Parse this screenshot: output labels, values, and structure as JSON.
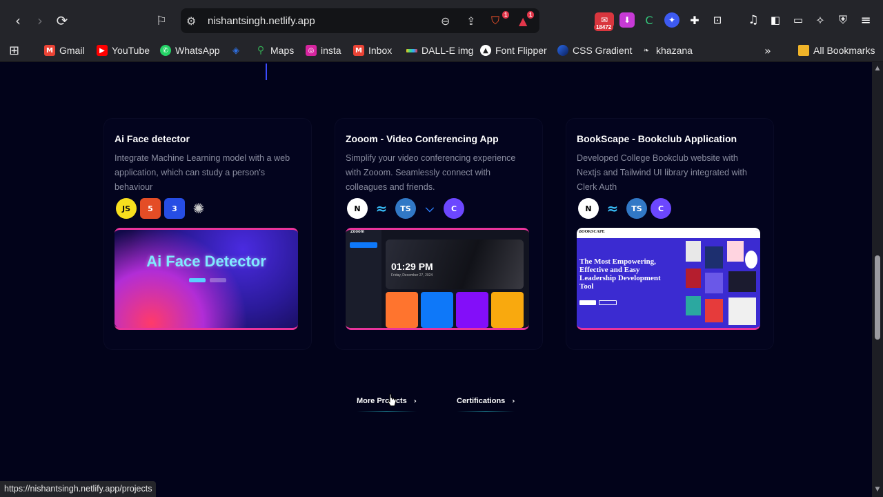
{
  "browser": {
    "url": "nishantsingh.netlify.app",
    "extension_badges": {
      "brave": "1",
      "alert": "1",
      "counter": "18472"
    },
    "status_url": "https://nishantsingh.netlify.app/projects"
  },
  "bookmarks": [
    {
      "label": "Gmail",
      "icon": "gmail-icon",
      "color": "#ea4335"
    },
    {
      "label": "YouTube",
      "icon": "youtube-icon",
      "color": "#ff0000"
    },
    {
      "label": "WhatsApp",
      "icon": "whatsapp-icon",
      "color": "#25d366"
    },
    {
      "label": "",
      "icon": "bookmark-generic-icon",
      "color": "#2f6fe0"
    },
    {
      "label": "Maps",
      "icon": "maps-pin-icon",
      "color": "#34a853"
    },
    {
      "label": "insta",
      "icon": "instagram-icon",
      "color": "#d6249f"
    },
    {
      "label": "Inbox",
      "icon": "gmail-icon",
      "color": "#ea4335"
    },
    {
      "label": "DALL-E img",
      "icon": "dalle-icon",
      "color": "#f5c518"
    },
    {
      "label": "Font Flipper",
      "icon": "font-flipper-icon",
      "color": "#ffffff"
    },
    {
      "label": "CSS Gradient",
      "icon": "css-gradient-icon",
      "color": "#2a6ae8"
    },
    {
      "label": "khazana",
      "icon": "khazana-icon",
      "color": "#dddddd"
    }
  ],
  "all_bookmarks_label": "All Bookmarks",
  "projects": [
    {
      "title": "Ai Face detector",
      "description": "Integrate Machine Learning model with a web application, which can study a person's behaviour",
      "tech": [
        {
          "icon": "javascript-icon",
          "text": "JS"
        },
        {
          "icon": "html5-icon",
          "text": "5"
        },
        {
          "icon": "css3-icon",
          "text": "3"
        },
        {
          "icon": "openai-icon",
          "text": "✺"
        }
      ],
      "thumb_text": "Ai Face Detector"
    },
    {
      "title": "Zooom - Video Conferencing App",
      "description": "Simplify your video conferencing experience with Zooom. Seamlessly connect with colleagues and friends.",
      "tech": [
        {
          "icon": "nextjs-icon",
          "text": "N"
        },
        {
          "icon": "tailwind-icon",
          "text": "≈"
        },
        {
          "icon": "typescript-icon",
          "text": "TS"
        },
        {
          "icon": "stream-icon",
          "text": "⌵"
        },
        {
          "icon": "clerk-icon",
          "text": "C"
        }
      ],
      "thumb_brand": "Zooom",
      "thumb_time": "01:29 PM",
      "thumb_date": "Friday, December 27, 2024"
    },
    {
      "title": "BookScape - Bookclub Application",
      "description": "Developed College Bookclub website with Nextjs and Tailwind UI library integrated with Clerk Auth",
      "tech": [
        {
          "icon": "nextjs-icon",
          "text": "N"
        },
        {
          "icon": "tailwind-icon",
          "text": "≈"
        },
        {
          "icon": "typescript-icon",
          "text": "TS"
        },
        {
          "icon": "clerk-icon",
          "text": "C"
        }
      ],
      "thumb_logo": "BOOKSCAPE",
      "thumb_headline": "The Most Empowering, Effective and Easy Leadership Development Tool"
    }
  ],
  "buttons": {
    "more_projects": "More Projects",
    "certifications": "Certifications"
  }
}
